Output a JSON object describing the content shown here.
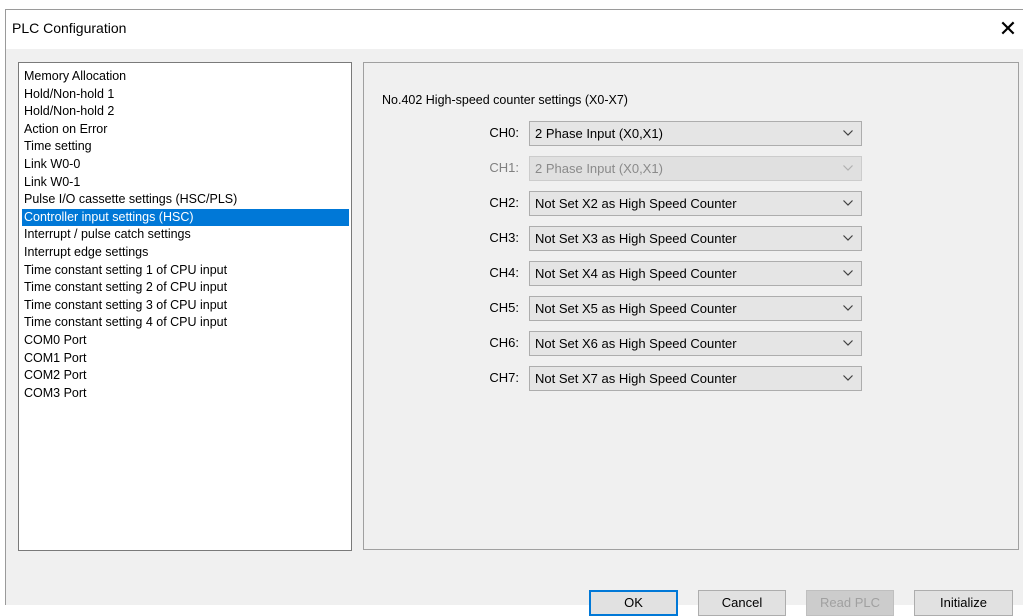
{
  "window": {
    "title": "PLC Configuration"
  },
  "icons": {
    "close": "close-icon",
    "dropdown": "chevron-down-icon"
  },
  "sidebar": {
    "selected_index": 8,
    "items": [
      "Memory Allocation",
      "Hold/Non-hold 1",
      "Hold/Non-hold 2",
      "Action on Error",
      "Time setting",
      "Link W0-0",
      "Link W0-1",
      "Pulse I/O cassette settings (HSC/PLS)",
      "Controller input settings (HSC)",
      "Interrupt / pulse catch settings",
      "Interrupt edge settings",
      "Time constant setting 1 of CPU input",
      "Time constant setting 2 of CPU input",
      "Time constant setting 3 of CPU input",
      "Time constant setting 4 of CPU input",
      "COM0 Port",
      "COM1 Port",
      "COM2 Port",
      "COM3 Port"
    ]
  },
  "panel": {
    "title": "No.402 High-speed counter settings (X0-X7)",
    "channels": [
      {
        "label": "CH0:",
        "value": "2 Phase Input (X0,X1)",
        "enabled": true
      },
      {
        "label": "CH1:",
        "value": "2 Phase Input (X0,X1)",
        "enabled": false
      },
      {
        "label": "CH2:",
        "value": "Not Set X2 as High Speed Counter",
        "enabled": true
      },
      {
        "label": "CH3:",
        "value": "Not Set X3 as High Speed Counter",
        "enabled": true
      },
      {
        "label": "CH4:",
        "value": "Not Set X4 as High Speed Counter",
        "enabled": true
      },
      {
        "label": "CH5:",
        "value": "Not Set X5 as High Speed Counter",
        "enabled": true
      },
      {
        "label": "CH6:",
        "value": "Not Set X6 as High Speed Counter",
        "enabled": true
      },
      {
        "label": "CH7:",
        "value": "Not Set X7 as High Speed Counter",
        "enabled": true
      }
    ]
  },
  "buttons": {
    "ok": "OK",
    "cancel": "Cancel",
    "read_plc": "Read PLC",
    "initialize": "Initialize"
  },
  "colors": {
    "selection": "#0078d7",
    "default_button_border": "#0078d7"
  }
}
